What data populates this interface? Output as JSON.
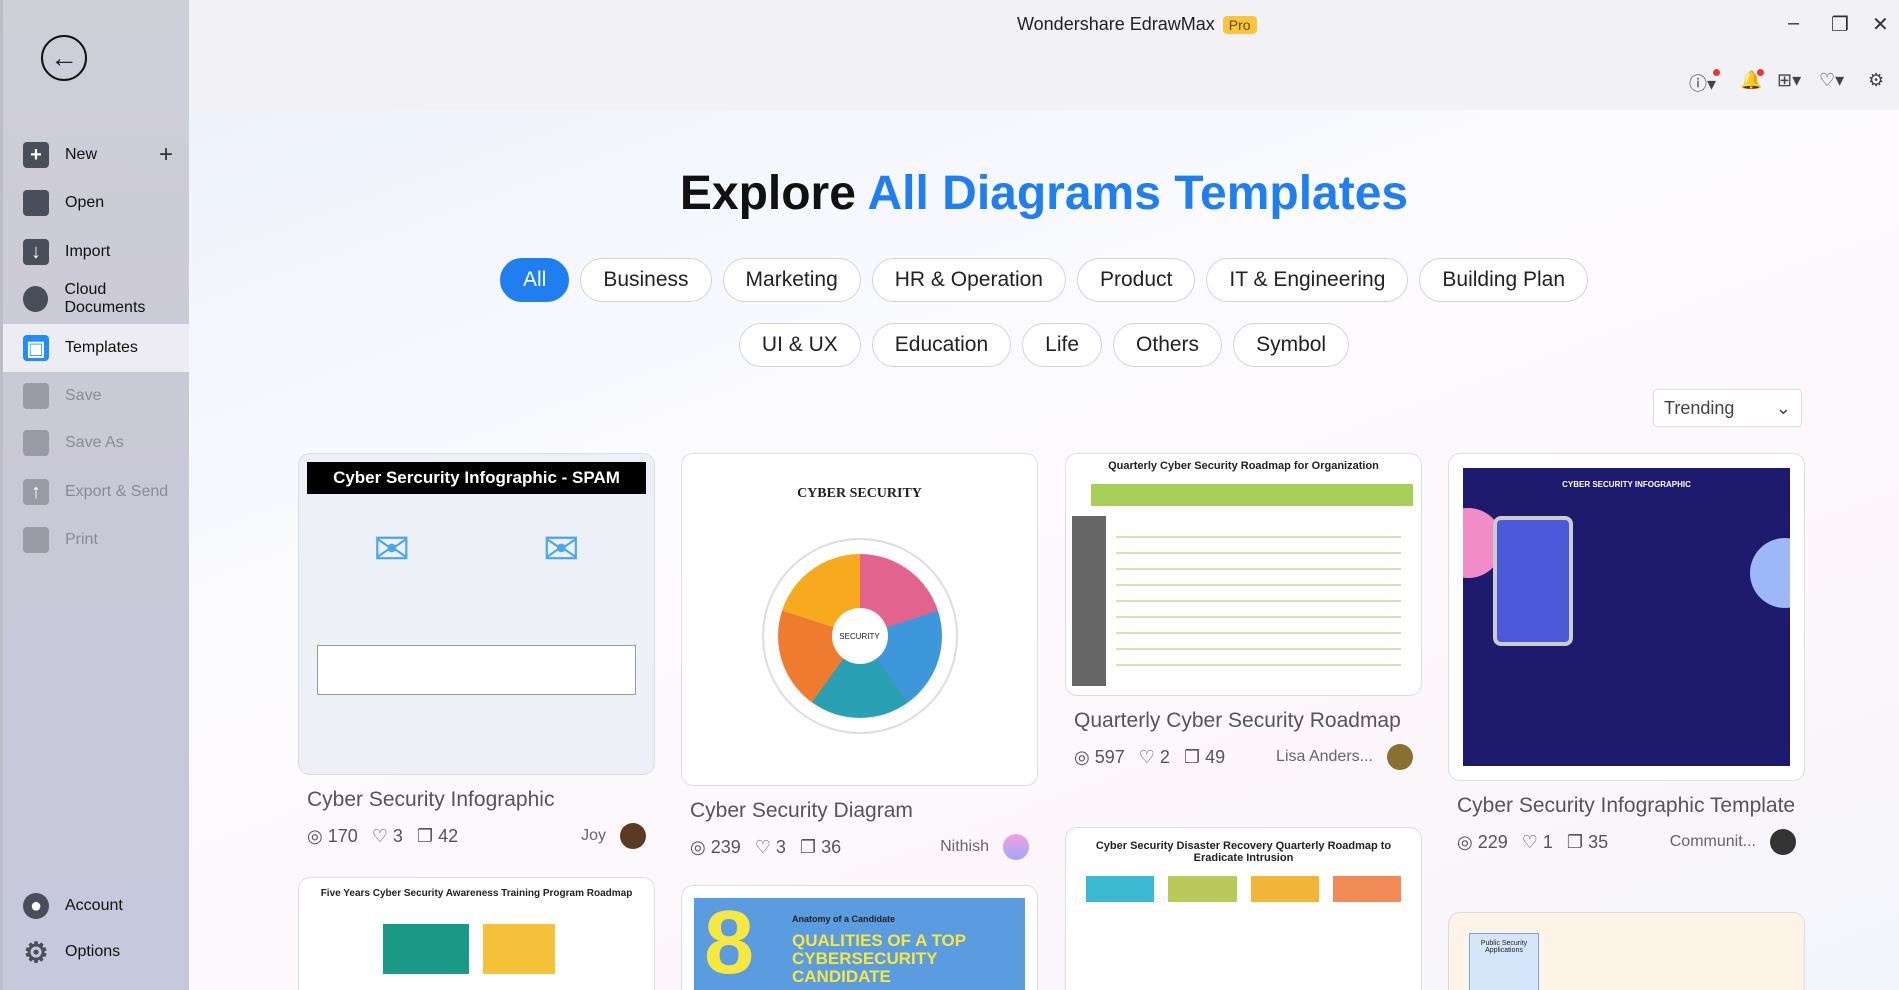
{
  "app": {
    "title": "Wondershare EdrawMax",
    "badge": "Pro"
  },
  "sidebar": {
    "items": [
      {
        "label": "New",
        "icon": "plus-square-icon"
      },
      {
        "label": "Open",
        "icon": "folder-icon"
      },
      {
        "label": "Import",
        "icon": "import-icon"
      },
      {
        "label": "Cloud Documents",
        "icon": "cloud-icon"
      },
      {
        "label": "Templates",
        "icon": "templates-icon"
      },
      {
        "label": "Save",
        "icon": "save-icon"
      },
      {
        "label": "Save As",
        "icon": "save-as-icon"
      },
      {
        "label": "Export & Send",
        "icon": "export-icon"
      },
      {
        "label": "Print",
        "icon": "print-icon"
      }
    ],
    "bottom": [
      {
        "label": "Account",
        "icon": "account-icon"
      },
      {
        "label": "Options",
        "icon": "gear-icon"
      }
    ]
  },
  "heading": {
    "prefix": "Explore",
    "highlight": "All Diagrams Templates"
  },
  "categories_row1": [
    "All",
    "Business",
    "Marketing",
    "HR & Operation",
    "Product",
    "IT & Engineering",
    "Building Plan"
  ],
  "categories_row2": [
    "UI & UX",
    "Education",
    "Life",
    "Others",
    "Symbol"
  ],
  "selected_category": "All",
  "sort": {
    "value": "Trending"
  },
  "accent": "#1f7ff0",
  "cards": [
    {
      "title": "Cyber Security Infographic",
      "views": "170",
      "likes": "3",
      "copies": "42",
      "author": "Joy",
      "thumb_title": "Cyber Sercurity Infographic - SPAM"
    },
    {
      "title": "Cyber Security Diagram",
      "views": "239",
      "likes": "3",
      "copies": "36",
      "author": "Nithish",
      "thumb_title": "CYBER SECURITY"
    },
    {
      "title": "Quarterly Cyber Security Roadmap",
      "views": "597",
      "likes": "2",
      "copies": "49",
      "author": "Lisa Anders...",
      "thumb_title": "Quarterly Cyber Security Roadmap for Organization"
    },
    {
      "title": "Cyber Security Infographic Template",
      "views": "229",
      "likes": "1",
      "copies": "35",
      "author": "Communit...",
      "thumb_title": "CYBER SECURITY INFOGRAPHIC"
    },
    {
      "thumb_title": "Five Years Cyber Security Awareness Training Program Roadmap"
    },
    {
      "thumb_title": "QUALITIES OF A  TOP CYBERSECURITY CANDIDATE",
      "thumb_sub": "Anatomy of a Candidate"
    },
    {
      "thumb_title": "Cyber Security Disaster Recovery Quarterly Roadmap to Eradicate Intrusion"
    },
    {
      "thumb_title": "Public Security Applications"
    }
  ]
}
